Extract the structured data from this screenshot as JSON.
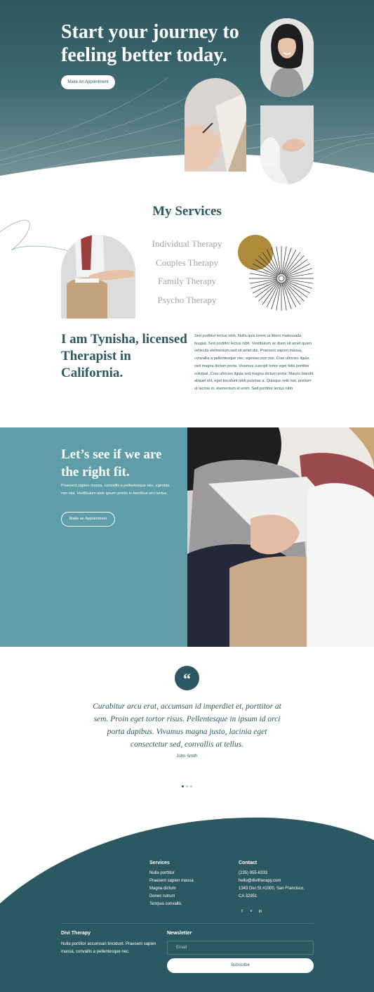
{
  "hero": {
    "title": "Start your journey to feeling better today.",
    "cta_label": "Make An Appointment"
  },
  "services": {
    "heading": "My Services",
    "items": [
      "Individual Therapy",
      "Couples Therapy",
      "Family Therapy",
      "Psycho Therapy"
    ]
  },
  "about": {
    "heading": "I am Tynisha, licensed Therapist in California.",
    "body": "Sed porttitor lectus nibh. Nulla quis lorem ut libero malesuada feugiat. Sed porttitor lectus nibh. Vestibulum ac diam sit amet quam vehicula elementum sed sit amet dui. Praesent sapien massa, convallis a pellentesque nec, egestas non nisi. Cras ultricies ligula sed magna dictum porta. Vivamus suscipit tortor eget felis porttitor volutpat. Cras ultricies ligula sed magna dictum porta. Mauris blandit aliquet elit, eget tincidunt nibh pulvinar a. Quisque velit nisi, pretium ut lacinia in, elementum id enim. Sed porttitor lectus nibh."
  },
  "fit": {
    "heading": "Let’s see if we are the right fit.",
    "body": "Praesent sapien massa, convallis a pellentesque nec, egestas non nisi. Vestibulum ante ipsum primis in faucibus orci luctus.",
    "cta_label": "Make an Appointment"
  },
  "testimonial": {
    "quote_glyph": "“",
    "quote": "Curabitur arcu erat, accumsan id imperdiet et, porttitor at sem. Proin eget tortor risus. Pellentesque in ipsum id orci porta dapibus. Vivamus magna justo, lacinia eget consectetur sed, convallis at tellus.",
    "author": "John Smith",
    "slide_count": 3,
    "active_slide": 1
  },
  "footer": {
    "services_heading": "Services",
    "services_items": [
      "Nulla porttitor",
      "Praesent sapien massa",
      "Magna dictum",
      "Donec rutrum",
      "Tempus convallis"
    ],
    "contact_heading": "Contact",
    "phone": "(235) 955-6333",
    "email": "hello@divitherapy.com",
    "address_line1": "1343 Divi St #1000, San Francisco,",
    "address_line2": "CA 32951",
    "social_icons": [
      "facebook-icon",
      "twitter-icon",
      "linkedin-icon"
    ],
    "social_glyphs": [
      "f",
      "˅",
      "in"
    ],
    "brand_heading": "Divi Therapy",
    "brand_text": "Nulla porttitor accumsan tincidunt. Praesent sapien massa, convallis a pellentesque nec.",
    "newsletter_heading": "Newsletter",
    "email_placeholder": "Email",
    "subscribe_label": "Subscribe"
  },
  "colors": {
    "primary": "#2c5961",
    "teal_panel": "#5f9ea9",
    "accent_mustard": "#ad8b3a",
    "muted_text": "#a3a3a3"
  }
}
